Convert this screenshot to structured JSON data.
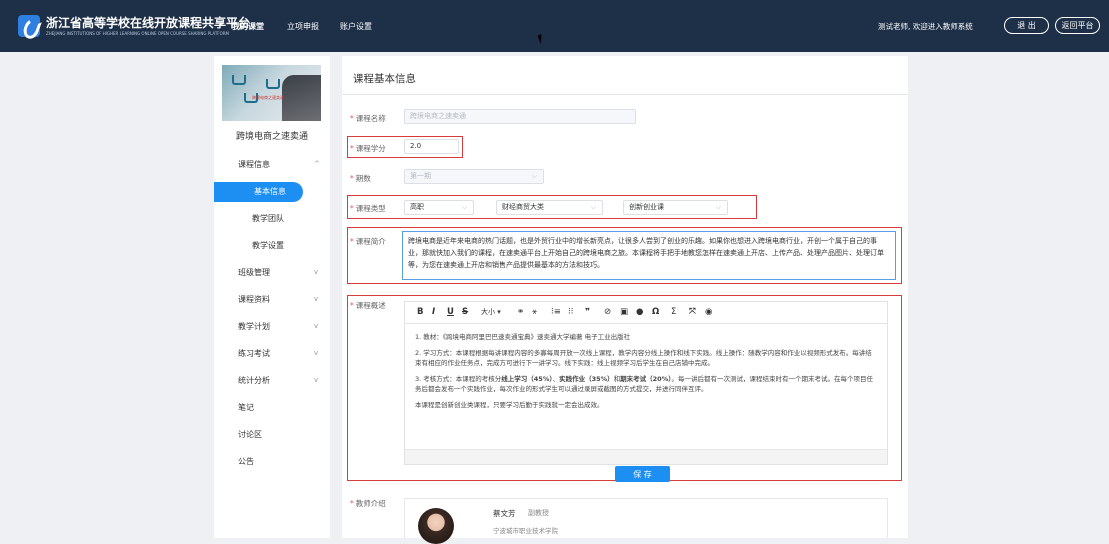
{
  "header": {
    "brand_title": "浙江省高等学校在线开放课程共享平台",
    "brand_subtitle": "ZHEJIANG INSTITUTIONS OF HIGHER LEARNING ONLINE OPEN COURSE SHARING PLATFORM",
    "nav": [
      "我的课堂",
      "立项申报",
      "账户设置"
    ],
    "welcome": "测试老师, 欢迎进入教师系统",
    "logout": "退 出",
    "back": "返回平台"
  },
  "sidebar": {
    "thumb_label": "跨境电商之速卖通",
    "course_name": "跨境电商之速卖通",
    "menu": [
      {
        "label": "课程信息",
        "chevron": "^"
      },
      {
        "label": "基本信息",
        "active": true
      },
      {
        "label": "教学团队"
      },
      {
        "label": "教学设置"
      },
      {
        "label": "班级管理",
        "chevron": "v"
      },
      {
        "label": "课程资料",
        "chevron": "v"
      },
      {
        "label": "教学计划",
        "chevron": "v"
      },
      {
        "label": "练习考试",
        "chevron": "v"
      },
      {
        "label": "统计分析",
        "chevron": "v"
      },
      {
        "label": "笔记"
      },
      {
        "label": "讨论区"
      },
      {
        "label": "公告"
      }
    ]
  },
  "main": {
    "title": "课程基本信息",
    "fields": {
      "course_name_label": "课程名称",
      "course_name_value": "跨境电商之速卖通",
      "credits_label": "课程学分",
      "credits_value": "2.0",
      "term_label": "期数",
      "term_value": "第一期",
      "type_label": "课程类型",
      "type_level": "高职",
      "type_category": "财经商贸大类",
      "type_kind": "创新创业课",
      "intro_label": "课程简介",
      "intro_text": "跨境电商是近年来电商的热门话题，也是外贸行业中的增长新亮点，让很多人尝到了创业的乐趣。如果你也想进入跨境电商行业，开创一个属于自己的事业，那就快加入我们的课程，在速卖通平台上开始自己的跨境电商之旅。本课程将手把手地教您怎样在速卖通上开店、上传产品、处理产品图片、处理订单等，为您在速卖通上开店和销售产品提供最基本的方法和技巧。",
      "overview_label": "课程概述",
      "teacher_label": "教师介绍"
    },
    "toolbar": [
      "B",
      "I",
      "U",
      "S",
      "大小 ▾",
      "⚭",
      "⚹",
      "⁝≡",
      "⁝⁝",
      "❞",
      "⊘",
      "▣",
      "●",
      "Ω",
      "Σ",
      "⤧",
      "◉"
    ],
    "overview": {
      "p1": "1. 教材：《跨境电商阿里巴巴速卖通宝典》速卖通大学编著 电子工业出版社",
      "p2": "2. 学习方式：本课程根据每讲课程内容的多寡每周开放一次线上课程，教学内容分线上操作和线下实践。线上操作：随教学内容和作业以视频形式发布。每讲结束有相应的作业任务点，完成方可进行下一讲学习。线下实践：线上视频学习后学生在自己店铺中完成。",
      "p3_pre": "3. 考核方式：本课程的考核分",
      "p3_b1": "线上学习（45%）",
      "p3_mid1": "、",
      "p3_b2": "实践作业（35%）",
      "p3_mid2": "和",
      "p3_b3": "期末考试（20%）",
      "p3_post": "。每一讲后都有一次测试，课程结束时有一个期末考试。在每个项目任务后都会发布一个实践作业，每次作业的形式学生可以通过录屏或截图的方式提交，并进行同伴互评。",
      "p4": "本课程是创新创业类课程，只要学习后勤于实践就一定会出成效。"
    },
    "save": "保 存",
    "teacher": {
      "name": "蔡文芳",
      "title": "副教授",
      "school": "宁波城市职业技术学院"
    }
  }
}
